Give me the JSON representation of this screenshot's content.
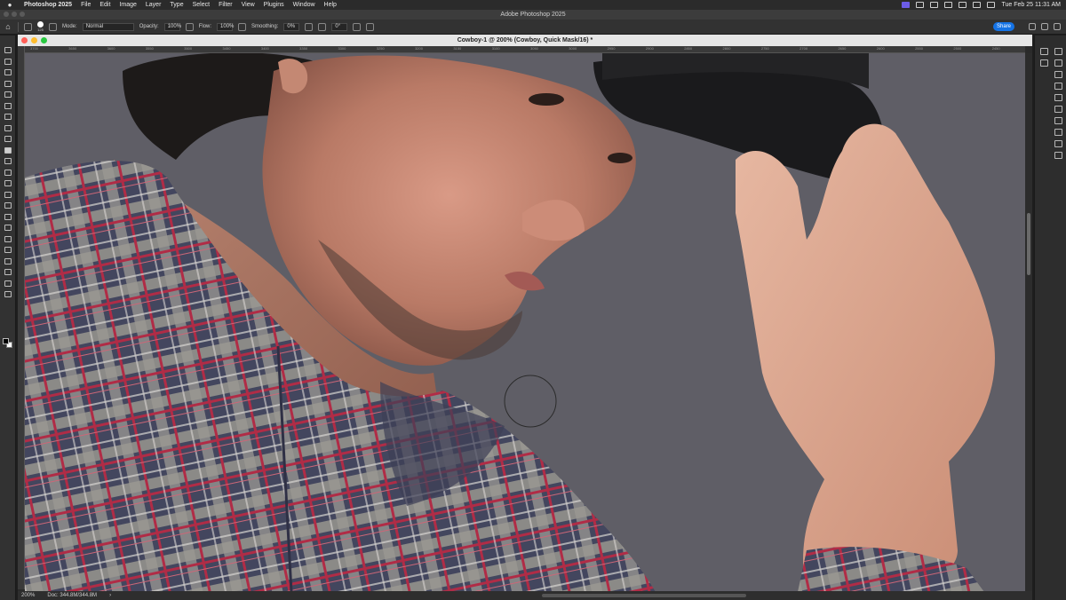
{
  "menubar": {
    "app_name": "Photoshop 2025",
    "menus": [
      "File",
      "Edit",
      "Image",
      "Layer",
      "Type",
      "Select",
      "Filter",
      "View",
      "Plugins",
      "Window",
      "Help"
    ],
    "clock": "Tue Feb 25  11:31 AM"
  },
  "app_window": {
    "title": "Adobe Photoshop 2025"
  },
  "options_bar": {
    "brush_size": "125",
    "mode_label": "Mode:",
    "mode_value": "Normal",
    "opacity_label": "Opacity:",
    "opacity_value": "100%",
    "flow_label": "Flow:",
    "flow_value": "100%",
    "smoothing_label": "Smoothing:",
    "smoothing_value": "0%",
    "angle_value": "0°",
    "share_label": "Share"
  },
  "document": {
    "title": "Cowboy-1 @ 200% (Cowboy, Quick Mask/16) *",
    "ruler_top_ticks": [
      "3700",
      "3650",
      "3600",
      "3550",
      "3500",
      "3450",
      "3400",
      "3350",
      "3300",
      "3250",
      "3200",
      "3150",
      "3100",
      "3050",
      "3000",
      "2950",
      "2900",
      "2850",
      "2800",
      "2750",
      "2700",
      "2650",
      "2600",
      "2550",
      "2500",
      "2450"
    ],
    "canvas_background": "#5d5c64"
  },
  "status_bar": {
    "zoom": "200%",
    "doc_info": "Doc: 344.8M/344.8M"
  },
  "colors": {
    "foreground": "#000000",
    "background": "#ffffff",
    "share_button": "#1473e6",
    "active_menu_icon": "#6c5ce7"
  },
  "tools": [
    "move-tool",
    "artboard-tool",
    "marquee-tool",
    "lasso-tool",
    "quick-select-tool",
    "crop-tool",
    "frame-tool",
    "eyedropper-tool",
    "spot-healing-tool",
    "brush-tool",
    "clone-stamp-tool",
    "history-brush-tool",
    "eraser-tool",
    "gradient-tool",
    "blur-tool",
    "dodge-tool",
    "pen-tool",
    "type-tool",
    "path-select-tool",
    "rectangle-tool",
    "hand-tool",
    "zoom-tool",
    "more-tools"
  ]
}
